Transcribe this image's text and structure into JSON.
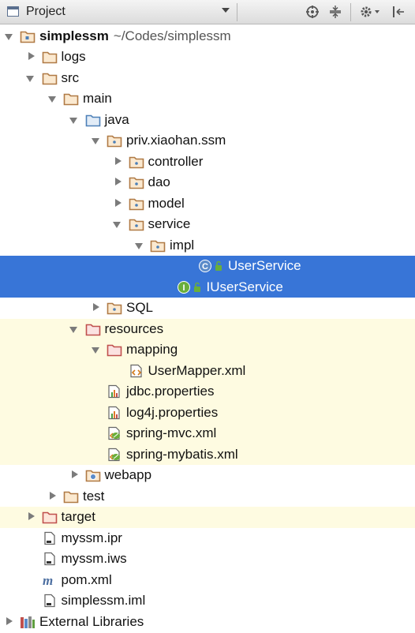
{
  "panel": {
    "title": "Project",
    "toolbar_icons": [
      "panel-icon",
      "dropdown-icon",
      "locate-icon",
      "collapse-all-icon",
      "settings-icon",
      "hide-panel-icon"
    ]
  },
  "tree": [
    {
      "name": "simplessm",
      "path": "~/Codes/simplessm",
      "icon": "project-folder",
      "state": "expanded"
    },
    {
      "name": "logs",
      "icon": "folder",
      "state": "collapsed"
    },
    {
      "name": "src",
      "icon": "folder",
      "state": "expanded"
    },
    {
      "name": "main",
      "icon": "folder",
      "state": "expanded"
    },
    {
      "name": "java",
      "icon": "source-folder",
      "state": "expanded"
    },
    {
      "name": "priv.xiaohan.ssm",
      "icon": "package",
      "state": "expanded"
    },
    {
      "name": "controller",
      "icon": "package",
      "state": "collapsed"
    },
    {
      "name": "dao",
      "icon": "package",
      "state": "collapsed"
    },
    {
      "name": "model",
      "icon": "package",
      "state": "collapsed"
    },
    {
      "name": "service",
      "icon": "package",
      "state": "expanded"
    },
    {
      "name": "impl",
      "icon": "package",
      "state": "expanded"
    },
    {
      "name": "UserService",
      "icon": "class",
      "state": "leaf",
      "selected": true
    },
    {
      "name": "IUserService",
      "icon": "interface",
      "state": "leaf",
      "selected": true
    },
    {
      "name": "SQL",
      "icon": "package",
      "state": "collapsed"
    },
    {
      "name": "resources",
      "icon": "resources-folder",
      "state": "expanded"
    },
    {
      "name": "mapping",
      "icon": "resources-folder",
      "state": "expanded"
    },
    {
      "name": "UserMapper.xml",
      "icon": "xml-file",
      "state": "leaf"
    },
    {
      "name": "jdbc.properties",
      "icon": "properties-file",
      "state": "leaf"
    },
    {
      "name": "log4j.properties",
      "icon": "properties-file",
      "state": "leaf"
    },
    {
      "name": "spring-mvc.xml",
      "icon": "spring-xml-file",
      "state": "leaf"
    },
    {
      "name": "spring-mybatis.xml",
      "icon": "spring-xml-file",
      "state": "leaf"
    },
    {
      "name": "webapp",
      "icon": "web-folder",
      "state": "collapsed"
    },
    {
      "name": "test",
      "icon": "folder",
      "state": "collapsed"
    },
    {
      "name": "target",
      "icon": "excluded-folder",
      "state": "collapsed"
    },
    {
      "name": "myssm.ipr",
      "icon": "file",
      "state": "leaf"
    },
    {
      "name": "myssm.iws",
      "icon": "file",
      "state": "leaf"
    },
    {
      "name": "pom.xml",
      "icon": "maven-file",
      "state": "leaf"
    },
    {
      "name": "simplessm.iml",
      "icon": "file",
      "state": "leaf"
    },
    {
      "name": "External Libraries",
      "icon": "library",
      "state": "collapsed"
    }
  ],
  "colors": {
    "selection": "#3875d7",
    "resources_background": "#fefbe1",
    "folder_outline": "#b07a45",
    "source_folder": "#4d80b8",
    "resources_folder": "#c0504d"
  }
}
